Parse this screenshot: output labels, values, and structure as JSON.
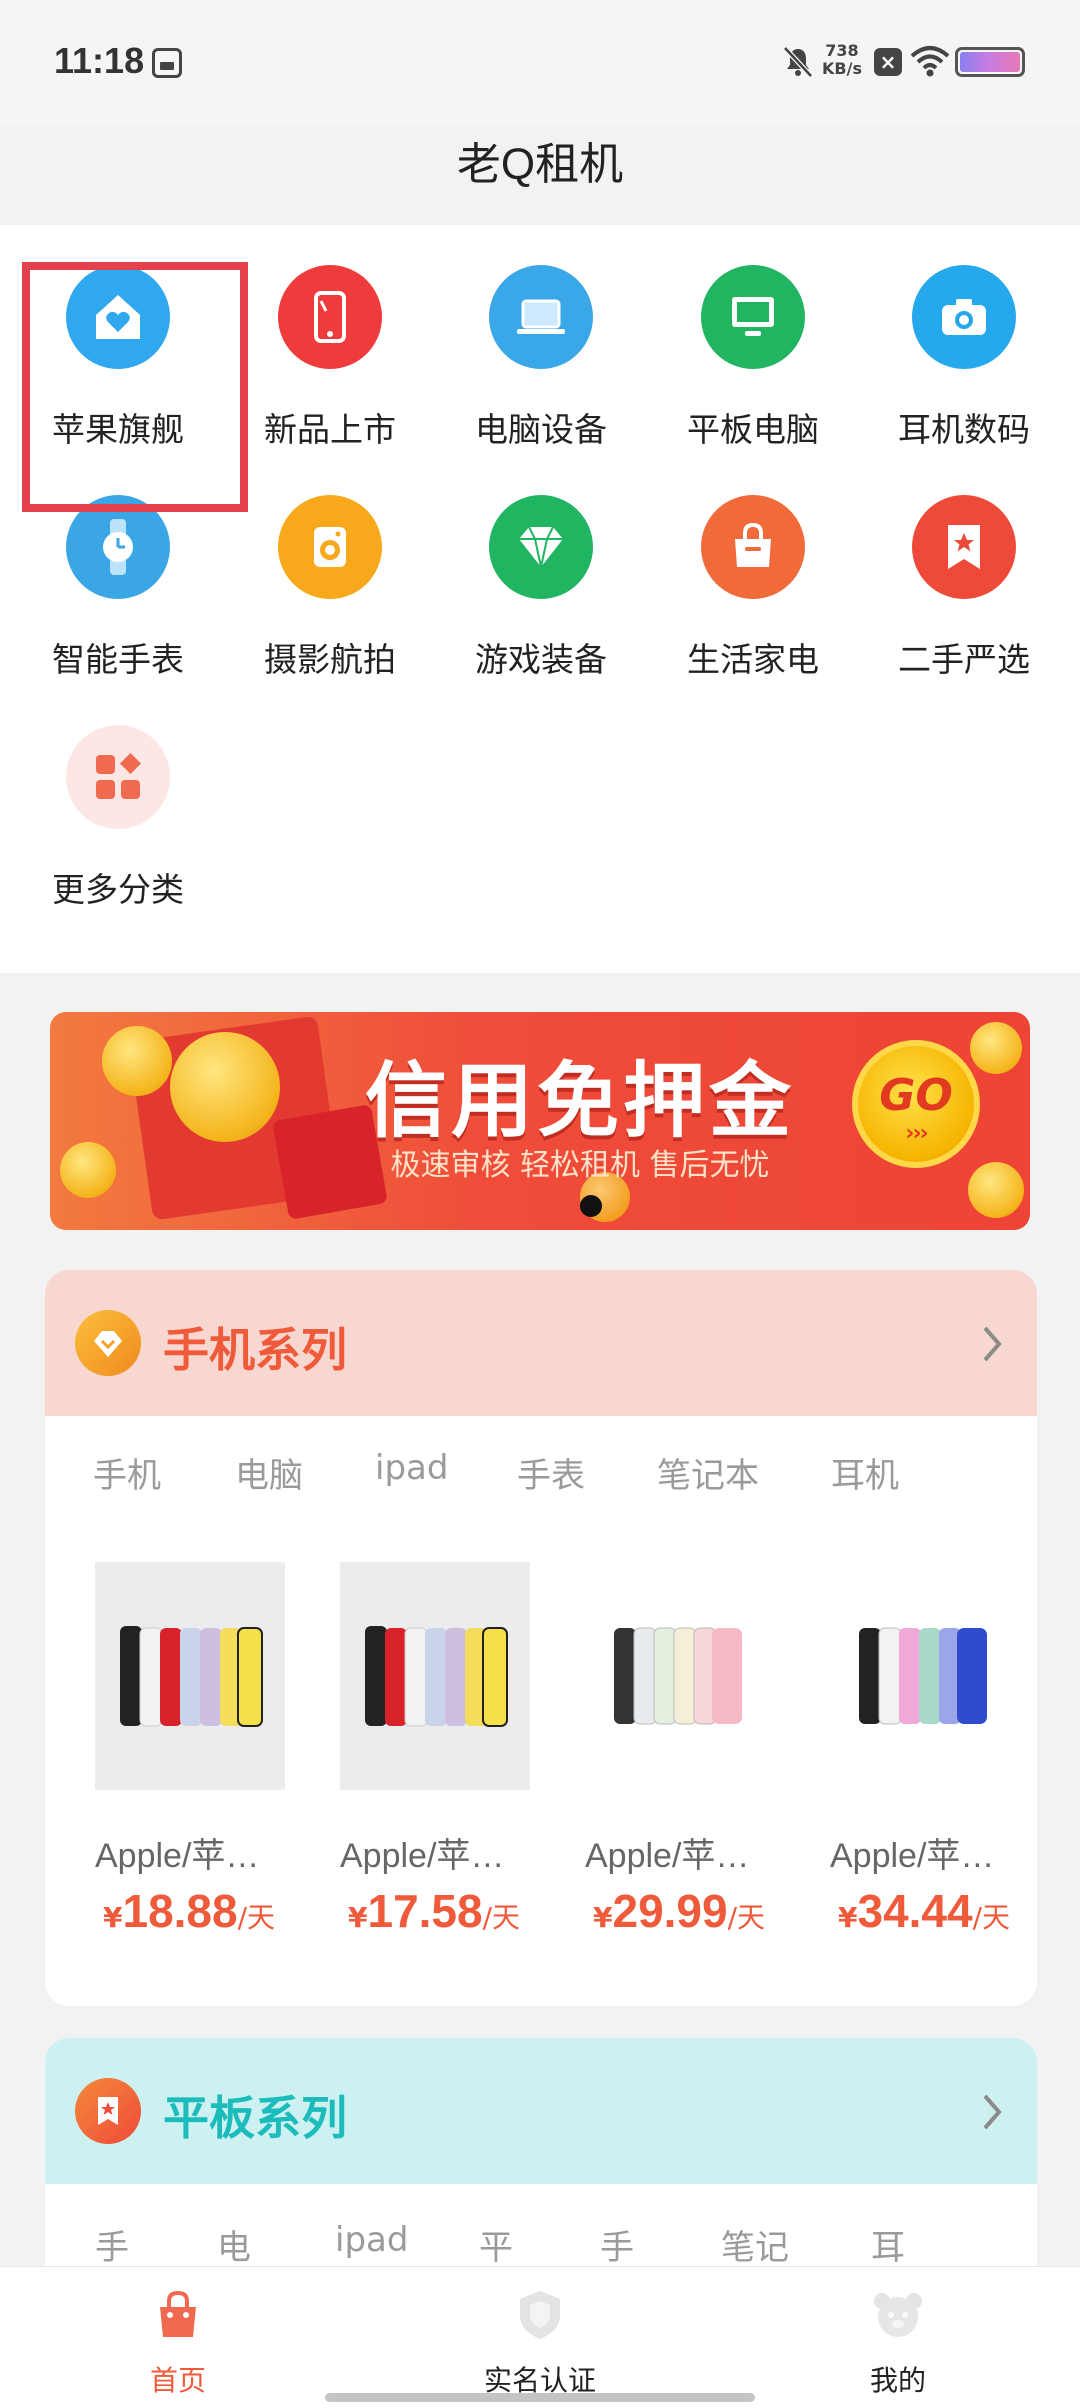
{
  "status_bar": {
    "time": "11:18",
    "net_speed_value": "738",
    "net_speed_unit": "KB/s",
    "battery_color": "#b77fe6"
  },
  "header": {
    "title": "老Q租机"
  },
  "categories": [
    {
      "label": "苹果旗舰",
      "icon": "house-heart-icon",
      "color": "#2fa8f0"
    },
    {
      "label": "新品上市",
      "icon": "phone-icon",
      "color": "#ef3b3b"
    },
    {
      "label": "电脑设备",
      "icon": "laptop-icon",
      "color": "#3aa7e8"
    },
    {
      "label": "平板电脑",
      "icon": "monitor-icon",
      "color": "#22b561"
    },
    {
      "label": "耳机数码",
      "icon": "camera-icon",
      "color": "#26a8ec"
    },
    {
      "label": "智能手表",
      "icon": "watch-icon",
      "color": "#3aa6e6"
    },
    {
      "label": "摄影航拍",
      "icon": "washer-icon",
      "color": "#f8a81b"
    },
    {
      "label": "游戏装备",
      "icon": "diamond-icon",
      "color": "#20b560"
    },
    {
      "label": "生活家电",
      "icon": "bag-icon",
      "color": "#f06a3a"
    },
    {
      "label": "二手严选",
      "icon": "ribbon-star-icon",
      "color": "#ee4a3a"
    },
    {
      "label": "更多分类",
      "icon": "grid-icon",
      "color": "#fde7e4"
    }
  ],
  "banner": {
    "title": "信用免押金",
    "subtitle": "极速审核 轻松租机 售后无忧",
    "go_label": "GO",
    "go_arrows": "›››"
  },
  "phone_series": {
    "title": "手机系列",
    "tabs": [
      "手机",
      "电脑",
      "ipad",
      "手表",
      "笔记本",
      "耳机"
    ],
    "products": [
      {
        "name": "Apple/苹…",
        "yen": "¥",
        "price": "18.88",
        "unit": "/天"
      },
      {
        "name": "Apple/苹…",
        "yen": "¥",
        "price": "17.58",
        "unit": "/天"
      },
      {
        "name": "Apple/苹…",
        "yen": "¥",
        "price": "29.99",
        "unit": "/天"
      },
      {
        "name": "Apple/苹…",
        "yen": "¥",
        "price": "34.44",
        "unit": "/天"
      }
    ]
  },
  "tablet_series": {
    "title": "平板系列",
    "tabs": [
      "手",
      "电",
      "ipad",
      "平",
      "手",
      "笔记",
      "耳"
    ]
  },
  "bottom_nav": {
    "items": [
      {
        "label": "首页",
        "icon": "home-bag-icon",
        "active": true
      },
      {
        "label": "实名认证",
        "icon": "shield-icon",
        "active": false
      },
      {
        "label": "我的",
        "icon": "profile-bear-icon",
        "active": false
      }
    ]
  },
  "colors": {
    "accent": "#ee5a3a",
    "phone_series_bg": "#f8d7d0",
    "tablet_series_bg": "#cdf0f0",
    "tablet_title": "#1cbcbc"
  }
}
